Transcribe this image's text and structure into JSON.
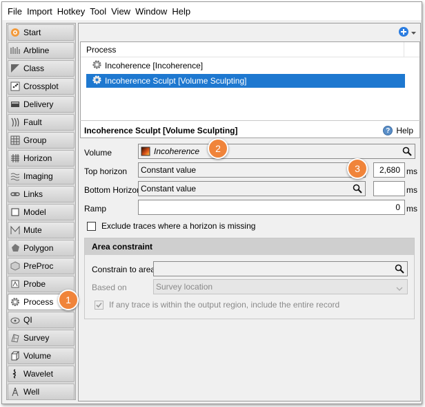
{
  "menu": [
    "File",
    "Import",
    "Hotkey",
    "Tool",
    "View",
    "Window",
    "Help"
  ],
  "sidebar": {
    "items": [
      {
        "label": "Start",
        "icon": "start-icon"
      },
      {
        "label": "Arbline",
        "icon": "arbline-icon"
      },
      {
        "label": "Class",
        "icon": "class-icon"
      },
      {
        "label": "Crossplot",
        "icon": "crossplot-icon"
      },
      {
        "label": "Delivery",
        "icon": "delivery-icon"
      },
      {
        "label": "Fault",
        "icon": "fault-icon"
      },
      {
        "label": "Group",
        "icon": "group-icon"
      },
      {
        "label": "Horizon",
        "icon": "horizon-icon"
      },
      {
        "label": "Imaging",
        "icon": "imaging-icon"
      },
      {
        "label": "Links",
        "icon": "links-icon"
      },
      {
        "label": "Model",
        "icon": "model-icon"
      },
      {
        "label": "Mute",
        "icon": "mute-icon"
      },
      {
        "label": "Polygon",
        "icon": "polygon-icon"
      },
      {
        "label": "PreProc",
        "icon": "preproc-icon"
      },
      {
        "label": "Probe",
        "icon": "probe-icon"
      },
      {
        "label": "Process",
        "icon": "process-icon"
      },
      {
        "label": "QI",
        "icon": "qi-icon"
      },
      {
        "label": "Survey",
        "icon": "survey-icon"
      },
      {
        "label": "Volume",
        "icon": "volume-icon"
      },
      {
        "label": "Wavelet",
        "icon": "wavelet-icon"
      },
      {
        "label": "Well",
        "icon": "well-icon"
      }
    ],
    "active": "Process"
  },
  "process_list": {
    "header": "Process",
    "rows": [
      {
        "label": "Incoherence [Incoherence]",
        "selected": false
      },
      {
        "label": "Incoherence Sculpt [Volume Sculpting]",
        "selected": true
      }
    ]
  },
  "detail": {
    "title": "Incoherence Sculpt [Volume Sculpting]",
    "help": "Help",
    "volume_label": "Volume",
    "volume_value": "Incoherence",
    "top_horizon_label": "Top horizon",
    "top_horizon_value": "Constant value",
    "top_horizon_num": "2,680",
    "top_unit": "ms",
    "bottom_horizon_label": "Bottom Horizon",
    "bottom_horizon_value": "Constant value",
    "bottom_horizon_num": "",
    "bottom_unit": "ms",
    "ramp_label": "Ramp",
    "ramp_value": "0",
    "ramp_unit": "ms",
    "exclude_label": "Exclude traces where a horizon is missing"
  },
  "area": {
    "header": "Area constraint",
    "constrain_label": "Constrain to area",
    "constrain_value": "",
    "based_on_label": "Based on",
    "based_on_value": "Survey location",
    "include_label": "If any trace is within the output region, include the entire record"
  },
  "badges": [
    "1",
    "2",
    "3"
  ],
  "colors": {
    "accent": "#1e78d0",
    "badge": "#f0843a"
  }
}
